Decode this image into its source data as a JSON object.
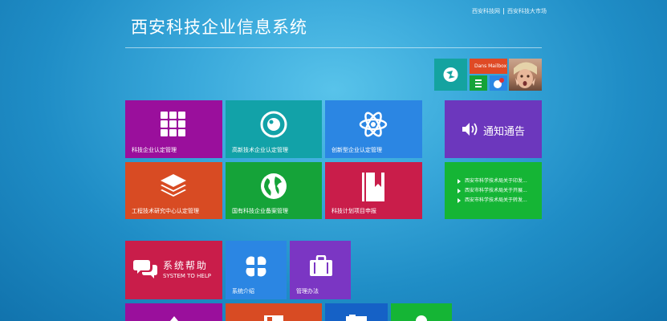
{
  "header": {
    "site_title": "西安科技企业信息系统",
    "top_links": [
      "西安科技网",
      "西安科技大市场"
    ]
  },
  "user_panel": {
    "mailbox_label": "Dans Mailbox"
  },
  "tiles": {
    "tech_enterprise": {
      "label": "科技企业认定管理",
      "icon": "grid-icon",
      "color": "#9a0f9c"
    },
    "hightech": {
      "label": "高新技术企业认定管理",
      "icon": "eye-icon",
      "color": "#12a2a8"
    },
    "innovative": {
      "label": "创新型企业认定管理",
      "icon": "atom-icon",
      "color": "#2b86e3"
    },
    "engineering_center": {
      "label": "工程技术研究中心认定管理",
      "icon": "layers-icon",
      "color": "#d84b23"
    },
    "state_owned": {
      "label": "国有科技企业备案管理",
      "icon": "globe-icon",
      "color": "#15a339"
    },
    "projects": {
      "label": "科技计划项目申报",
      "icon": "bookmark-book-icon",
      "color": "#c91d4a"
    },
    "notice_header": {
      "label": "通知通告",
      "icon": "speaker-icon",
      "color": "#6c37bd"
    },
    "notice_list": {
      "color": "#15b535",
      "items": [
        "西安市科学技术局关于印发...",
        "西安市科学技术局关于开展...",
        "西安市科学技术局关于转发..."
      ]
    },
    "help": {
      "title": "系统帮助",
      "subtitle": "SYSTEM TO HELP",
      "icon": "chat-bubbles-icon",
      "color": "#c91d4a"
    },
    "system_intro": {
      "label": "系统介绍",
      "icon": "clover-icon",
      "color": "#2b86e3"
    },
    "management": {
      "label": "管理办法",
      "icon": "briefcase-icon",
      "color": "#7b36c3"
    }
  },
  "bottom_row_colors": [
    "#9a0f9c",
    "#d84b23",
    "#1561c6",
    "#15b535"
  ]
}
